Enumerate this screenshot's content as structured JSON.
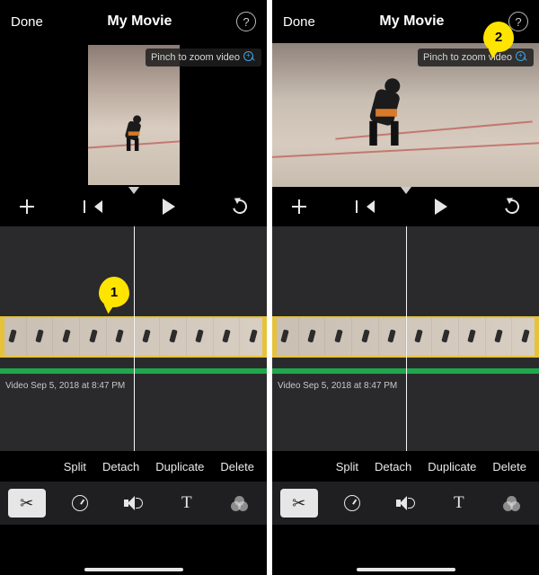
{
  "screens": [
    {
      "header": {
        "done": "Done",
        "title": "My Movie"
      },
      "hint": "Pinch to zoom video",
      "callout": "1",
      "timeline_meta": "Video Sep 5, 2018 at 8:47 PM",
      "actions": {
        "split": "Split",
        "detach": "Detach",
        "duplicate": "Duplicate",
        "delete": "Delete"
      }
    },
    {
      "header": {
        "done": "Done",
        "title": "My Movie"
      },
      "hint": "Pinch to zoom video",
      "callout": "2",
      "timeline_meta": "Video Sep 5, 2018 at 8:47 PM",
      "actions": {
        "split": "Split",
        "detach": "Detach",
        "duplicate": "Duplicate",
        "delete": "Delete"
      }
    }
  ]
}
